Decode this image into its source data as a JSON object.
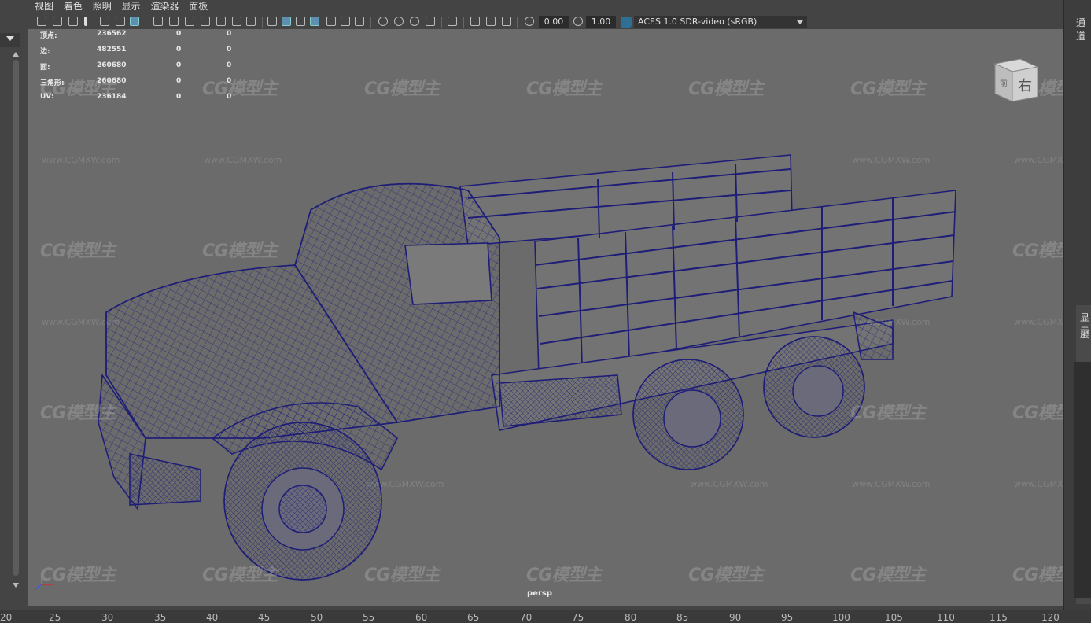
{
  "menu": [
    "视图",
    "着色",
    "照明",
    "显示",
    "渲染器",
    "面板"
  ],
  "toolbar": {
    "field_a": "0.00",
    "field_b": "1.00",
    "color_space": "ACES 1.0 SDR-video (sRGB)"
  },
  "hud": {
    "rows": [
      {
        "label": "顶点:",
        "v1": "236562",
        "v2": "0",
        "v3": "0"
      },
      {
        "label": "边:",
        "v1": "482551",
        "v2": "0",
        "v3": "0"
      },
      {
        "label": "面:",
        "v1": "260680",
        "v2": "0",
        "v3": "0"
      },
      {
        "label": "三角形:",
        "v1": "260680",
        "v2": "0",
        "v3": "0"
      },
      {
        "label": "UV:",
        "v1": "236184",
        "v2": "0",
        "v3": "0"
      }
    ]
  },
  "camera": "persp",
  "viewcube": {
    "face_label": "右",
    "side_label": "前"
  },
  "watermark": {
    "logo": "CG模型主",
    "url": "www.CGMXW.com"
  },
  "right_panel": {
    "tab": "通道",
    "label1": "显示",
    "label2": "层"
  },
  "timeline": [
    "20",
    "25",
    "30",
    "35",
    "40",
    "45",
    "50",
    "55",
    "60",
    "65",
    "70",
    "75",
    "80",
    "85",
    "90",
    "95",
    "100",
    "105",
    "110",
    "115",
    "120"
  ],
  "colors": {
    "wireframe": "#1e1e78",
    "viewport_bg": "#6b6b6b",
    "ui_bg": "#444444",
    "accent": "#5c8fb0"
  }
}
